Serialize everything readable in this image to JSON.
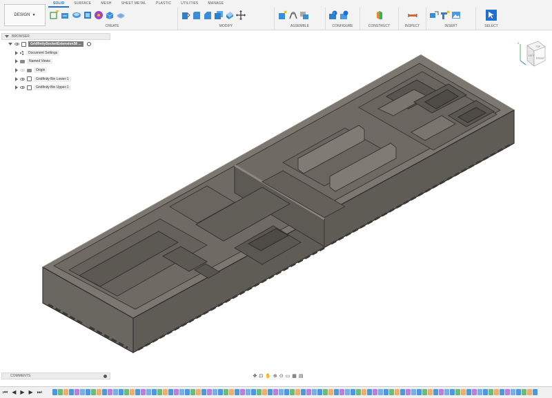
{
  "toolbar": {
    "design_label": "DESIGN",
    "tabs": [
      "SOLID",
      "SURFACE",
      "MESH",
      "SHEET METAL",
      "PLASTIC",
      "UTILITIES",
      "MANAGE"
    ],
    "groups": [
      "CREATE",
      "MODIFY",
      "ASSEMBLE",
      "CONFIGURE",
      "CONSTRUCT",
      "INSPECT",
      "INSERT",
      "SELECT"
    ]
  },
  "browser": {
    "title": "BROWSER",
    "root": "GridfinitySocketExtension38 ...",
    "items": [
      "Document Settings",
      "Named Views",
      "Origin",
      "Gridfinity Bin Lower:1",
      "Gridfinity Bin Upper:1"
    ]
  },
  "comments": {
    "title": "COMMENTS"
  },
  "colors": {
    "accent": "#1f6fd0",
    "model": "#6e6a62"
  },
  "icons": [
    "expand-icon",
    "visibility-icon",
    "folder-icon",
    "gear-icon",
    "component-icon",
    "viewcube-icon",
    "orbit-icon",
    "pan-icon",
    "zoom-icon",
    "display-settings-icon",
    "grid-icon",
    "play-icon"
  ]
}
